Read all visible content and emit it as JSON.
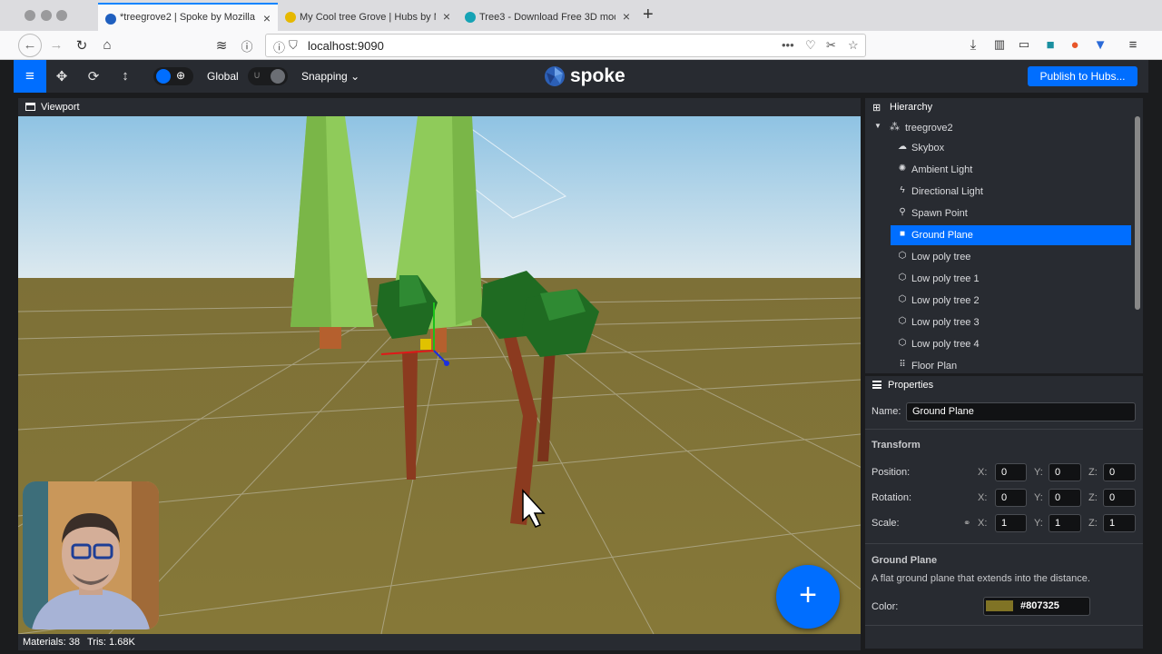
{
  "browser": {
    "tabs": [
      {
        "title": "*treegrove2 | Spoke by Mozilla",
        "favicon_color": "#1f5fbf"
      },
      {
        "title": "My Cool tree Grove | Hubs by M",
        "favicon_color": "#e6b800"
      },
      {
        "title": "Tree3 - Download Free 3D mod",
        "favicon_color": "#16a3b5"
      }
    ],
    "new_tab_label": "+",
    "url": "localhost:9090"
  },
  "toolbar": {
    "space_label": "Global",
    "snapping_label": "Snapping",
    "brand": "spoke",
    "publish_label": "Publish to Hubs..."
  },
  "viewport": {
    "title": "Viewport",
    "stats": {
      "materials": "Materials: 38",
      "tris": "Tris: 1.68K"
    },
    "add_label": "+"
  },
  "hierarchy": {
    "title": "Hierarchy",
    "root": "treegrove2",
    "items": [
      {
        "label": "Skybox",
        "icon": "cloud-icon"
      },
      {
        "label": "Ambient Light",
        "icon": "sun-icon"
      },
      {
        "label": "Directional Light",
        "icon": "bolt-icon"
      },
      {
        "label": "Spawn Point",
        "icon": "street-view-icon"
      },
      {
        "label": "Ground Plane",
        "icon": "square-icon",
        "selected": true
      },
      {
        "label": "Low poly tree",
        "icon": "cube-icon"
      },
      {
        "label": "Low poly tree 1",
        "icon": "cube-icon"
      },
      {
        "label": "Low poly tree 2",
        "icon": "cube-icon"
      },
      {
        "label": "Low poly tree 3",
        "icon": "cube-icon"
      },
      {
        "label": "Low poly tree 4",
        "icon": "cube-icon"
      },
      {
        "label": "Floor Plan",
        "icon": "shoe-prints-icon"
      }
    ]
  },
  "properties": {
    "title": "Properties",
    "name_label": "Name:",
    "name_value": "Ground Plane",
    "transform_title": "Transform",
    "position": {
      "label": "Position:",
      "x": "0",
      "y": "0",
      "z": "0"
    },
    "rotation": {
      "label": "Rotation:",
      "x": "0",
      "y": "0",
      "z": "0"
    },
    "scale": {
      "label": "Scale:",
      "x": "1",
      "y": "1",
      "z": "1"
    },
    "axis_labels": {
      "x": "X:",
      "y": "Y:",
      "z": "Z:"
    },
    "component_title": "Ground Plane",
    "component_description": "A flat ground plane that extends into the distance.",
    "color_label": "Color:",
    "color_value": "#807325"
  },
  "colors": {
    "accent": "#006eff",
    "panel": "#282b31",
    "ground": "#807325",
    "sky_top": "#8fc3e3",
    "sky_bottom": "#dce9ef"
  }
}
